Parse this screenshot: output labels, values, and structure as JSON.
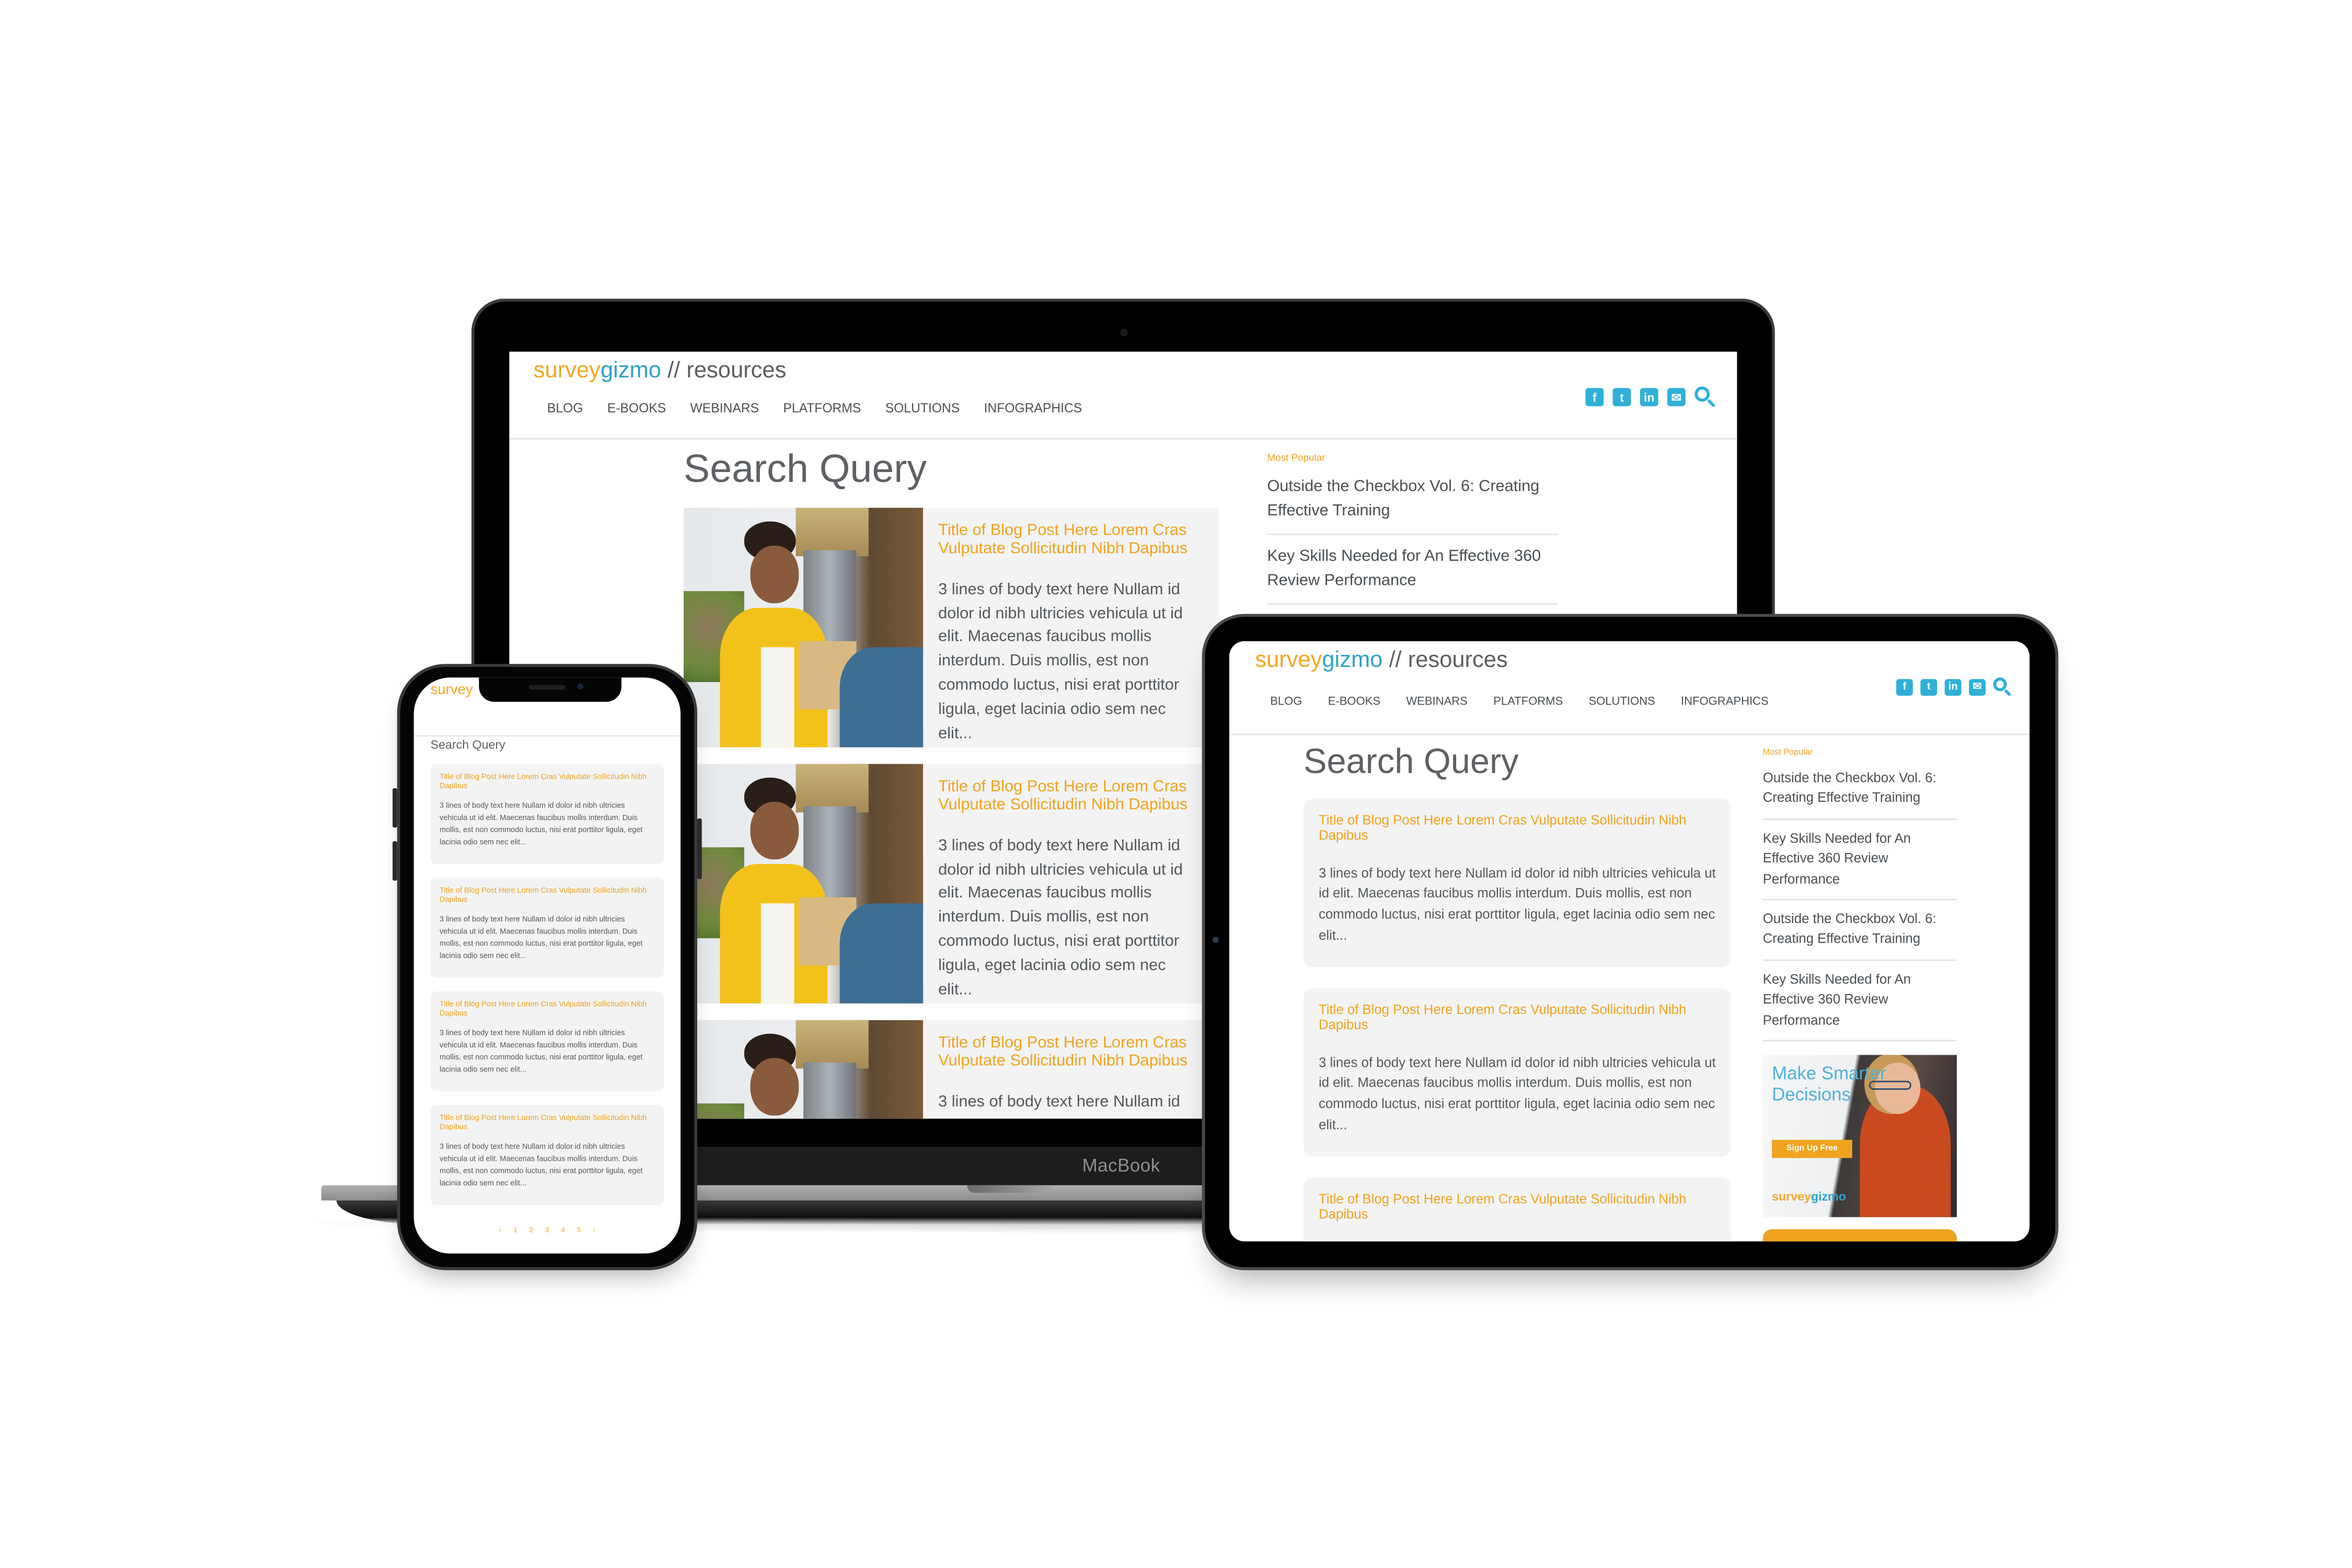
{
  "site": {
    "logo": {
      "part1": "survey",
      "part2": "gizmo",
      "suffix": " // resources"
    },
    "nav": [
      "BLOG",
      "E-BOOKS",
      "WEBINARS",
      "PLATFORMS",
      "SOLUTIONS",
      "INFOGRAPHICS"
    ],
    "social_icons": [
      {
        "name": "facebook-icon",
        "glyph": "f"
      },
      {
        "name": "twitter-icon",
        "glyph": "t"
      },
      {
        "name": "linkedin-icon",
        "glyph": "in"
      },
      {
        "name": "email-icon",
        "glyph": "✉"
      }
    ],
    "search_icon": "search-icon",
    "page_title": "Search Query",
    "most_popular_label": "Most Popular",
    "post_title": "Title of Blog Post Here Lorem Cras Vulputate Sollicitudin Nibh Dapibus",
    "post_body": "3 lines of body text here Nullam id dolor id nibh ultricies vehicula ut id elit. Maecenas faucibus mollis interdum. Duis mollis, est non commodo luctus, nisi erat porttitor ligula, eget lacinia odio sem nec elit..."
  },
  "laptop": {
    "brand_label": "MacBook",
    "popular": [
      "Outside the Checkbox Vol. 6: Creating Effective Training",
      "Key Skills Needed for An Effective 360 Review Performance"
    ],
    "posts": [
      {
        "title": "Title of Blog Post Here Lorem Cras Vulputate Sollicitudin Nibh Dapibus",
        "body": "3 lines of body text here Nullam id dolor id nibh ultricies vehicula ut id elit. Maecenas faucibus mollis interdum. Duis mollis, est non commodo luctus, nisi erat porttitor ligula, eget lacinia odio sem nec elit..."
      },
      {
        "title": "Title of Blog Post Here Lorem Cras Vulputate Sollicitudin Nibh Dapibus",
        "body": "3 lines of body text here Nullam id dolor id nibh ultricies vehicula ut id elit. Maecenas faucibus mollis interdum. Duis mollis, est non commodo luctus, nisi erat porttitor ligula, eget lacinia odio sem nec elit..."
      },
      {
        "title": "Title of Blog Post Here Lorem Cras Vulputate Sollicitudin Nibh Dapibus",
        "body": "3 lines of body text here Nullam id"
      }
    ]
  },
  "tablet": {
    "popular": [
      "Outside the Checkbox Vol. 6: Creating Effective Training",
      "Key Skills Needed for An Effective 360 Review Performance",
      "Outside the Checkbox Vol. 6: Creating Effective Training",
      "Key Skills Needed for An Effective 360 Review Performance"
    ],
    "ad": {
      "headline": "Make Smarter Decisions",
      "button": "Sign Up Free",
      "logo_part1": "survey",
      "logo_part2": "gizmo"
    },
    "posts": [
      {
        "title": "Title of Blog Post Here Lorem Cras Vulputate Sollicitudin Nibh Dapibus",
        "body": "3 lines of body text here Nullam id dolor id nibh ultricies vehicula ut id elit. Maecenas faucibus mollis interdum. Duis mollis, est non commodo luctus, nisi erat porttitor ligula, eget lacinia odio sem nec elit..."
      },
      {
        "title": "Title of Blog Post Here Lorem Cras Vulputate Sollicitudin Nibh Dapibus",
        "body": "3 lines of body text here Nullam id dolor id nibh ultricies vehicula ut id elit. Maecenas faucibus mollis interdum. Duis mollis, est non commodo luctus, nisi erat porttitor ligula, eget lacinia odio sem nec elit..."
      },
      {
        "title": "Title of Blog Post Here Lorem Cras Vulputate Sollicitudin Nibh Dapibus",
        "body": ""
      }
    ]
  },
  "phone": {
    "logo_visible": "survey",
    "posts": [
      {
        "title": "Title of Blog Post Here Lorem Cras Vulputate Sollicitudin Nibh Dapibus",
        "body": "3 lines of body text here Nullam id dolor id nibh ultricies vehicula ut id elit. Maecenas faucibus mollis interdum. Duis mollis, est non commodo luctus, nisi erat porttitor ligula, eget lacinia odio sem nec elit..."
      },
      {
        "title": "Title of Blog Post Here Lorem Cras Vulputate Sollicitudin Nibh Dapibus",
        "body": "3 lines of body text here Nullam id dolor id nibh ultricies vehicula ut id elit. Maecenas faucibus mollis interdum. Duis mollis, est non commodo luctus, nisi erat porttitor ligula, eget lacinia odio sem nec elit..."
      },
      {
        "title": "Title of Blog Post Here Lorem Cras Vulputate Sollicitudin Nibh Dapibus",
        "body": "3 lines of body text here Nullam id dolor id nibh ultricies vehicula ut id elit. Maecenas faucibus mollis interdum. Duis mollis, est non commodo luctus, nisi erat porttitor ligula, eget lacinia odio sem nec elit..."
      },
      {
        "title": "Title of Blog Post Here Lorem Cras Vulputate Sollicitudin Nibh Dapibus",
        "body": "3 lines of body text here Nullam id dolor id nibh ultricies vehicula ut id elit. Maecenas faucibus mollis interdum. Duis mollis, est non commodo luctus, nisi erat porttitor ligula, eget lacinia odio sem nec elit..."
      }
    ],
    "pagination": [
      "‹",
      "1",
      "2",
      "3",
      "4",
      "5",
      "›"
    ]
  },
  "colors": {
    "brand_orange": "#f0a31e",
    "brand_blue": "#2ea3c7",
    "icon_blue": "#2fb0d8",
    "card_bg": "#f3f3f3",
    "text_gray": "#54595d"
  }
}
